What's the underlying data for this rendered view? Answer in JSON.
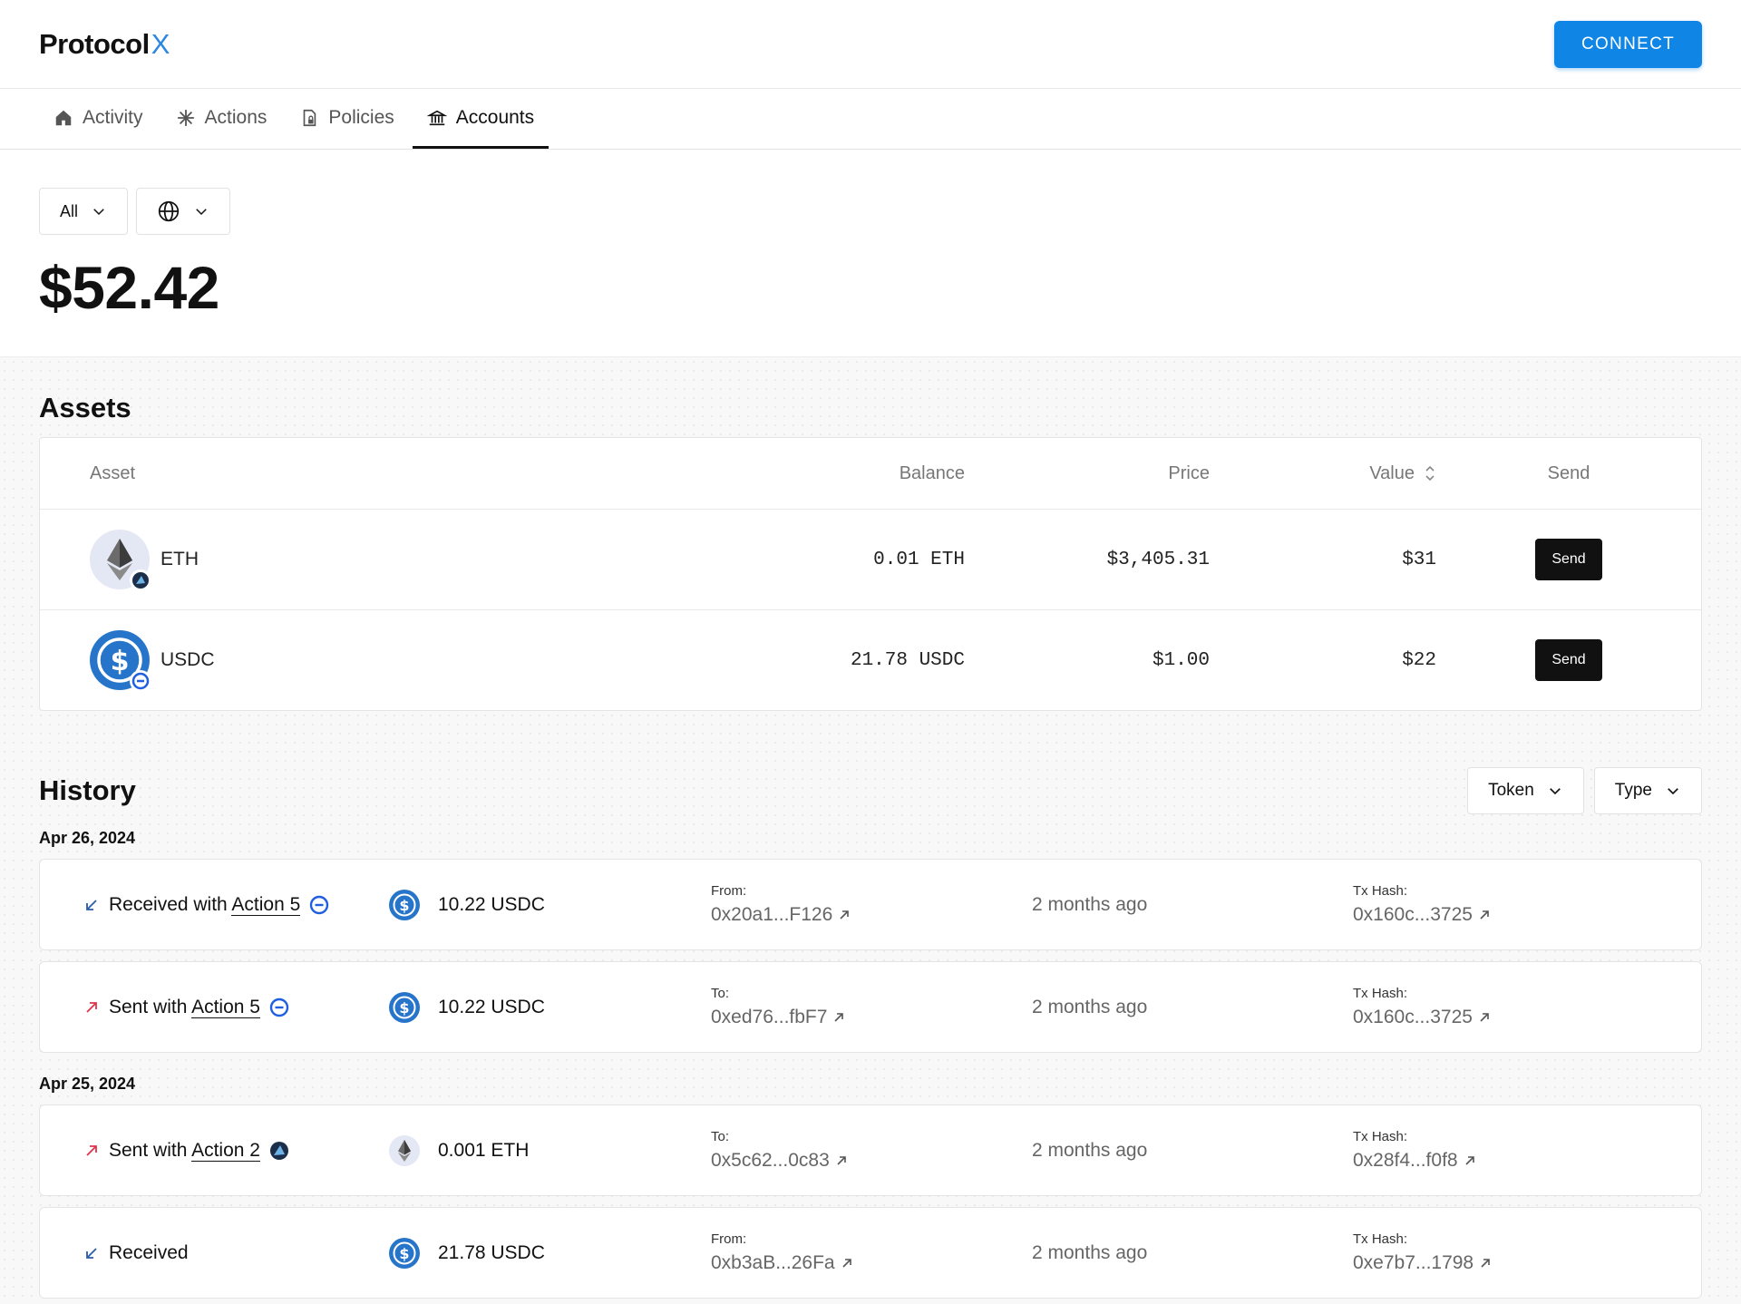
{
  "header": {
    "logo_text": "Protocol",
    "logo_x": "X",
    "connect_label": "CONNECT"
  },
  "tabs": [
    {
      "label": "Activity",
      "icon": "home-icon"
    },
    {
      "label": "Actions",
      "icon": "asterisk-icon"
    },
    {
      "label": "Policies",
      "icon": "document-lock-icon"
    },
    {
      "label": "Accounts",
      "icon": "bank-icon",
      "active": true
    }
  ],
  "filters": {
    "scope_label": "All",
    "network_icon": "globe-icon"
  },
  "total_balance": "$52.42",
  "assets": {
    "title": "Assets",
    "columns": {
      "asset": "Asset",
      "balance": "Balance",
      "price": "Price",
      "value": "Value",
      "send": "Send"
    },
    "rows": [
      {
        "name": "ETH",
        "balance": "0.01 ETH",
        "price": "$3,405.31",
        "value": "$31",
        "send_label": "Send",
        "icon": "eth-icon"
      },
      {
        "name": "USDC",
        "balance": "21.78 USDC",
        "price": "$1.00",
        "value": "$22",
        "send_label": "Send",
        "icon": "usdc-icon"
      }
    ]
  },
  "history": {
    "title": "History",
    "token_filter": "Token",
    "type_filter": "Type",
    "groups": [
      {
        "date": "Apr 26, 2024",
        "items": [
          {
            "direction": "received",
            "prefix": "Received with ",
            "action": "Action 5",
            "amount": "10.22 USDC",
            "addr_label": "From:",
            "addr": "0x20a1...F126",
            "time": "2 months ago",
            "hash_label": "Tx Hash:",
            "hash": "0x160c...3725"
          },
          {
            "direction": "sent",
            "prefix": "Sent with ",
            "action": "Action 5",
            "amount": "10.22 USDC",
            "addr_label": "To:",
            "addr": "0xed76...fbF7",
            "time": "2 months ago",
            "hash_label": "Tx Hash:",
            "hash": "0x160c...3725"
          }
        ]
      },
      {
        "date": "Apr 25, 2024",
        "items": [
          {
            "direction": "sent",
            "prefix": "Sent with ",
            "action": "Action 2",
            "amount": "0.001 ETH",
            "addr_label": "To:",
            "addr": "0x5c62...0c83",
            "time": "2 months ago",
            "hash_label": "Tx Hash:",
            "hash": "0x28f4...f0f8"
          },
          {
            "direction": "received",
            "prefix": "Received",
            "action": "",
            "amount": "21.78 USDC",
            "addr_label": "From:",
            "addr": "0xb3aB...26Fa",
            "time": "2 months ago",
            "hash_label": "Tx Hash:",
            "hash": "0xe7b7...1798"
          }
        ]
      }
    ]
  },
  "colors": {
    "accent": "#0f86e6",
    "received_arrow": "#2a5ca8",
    "sent_arrow": "#e0334a",
    "usdc_blue": "#2775ca"
  }
}
